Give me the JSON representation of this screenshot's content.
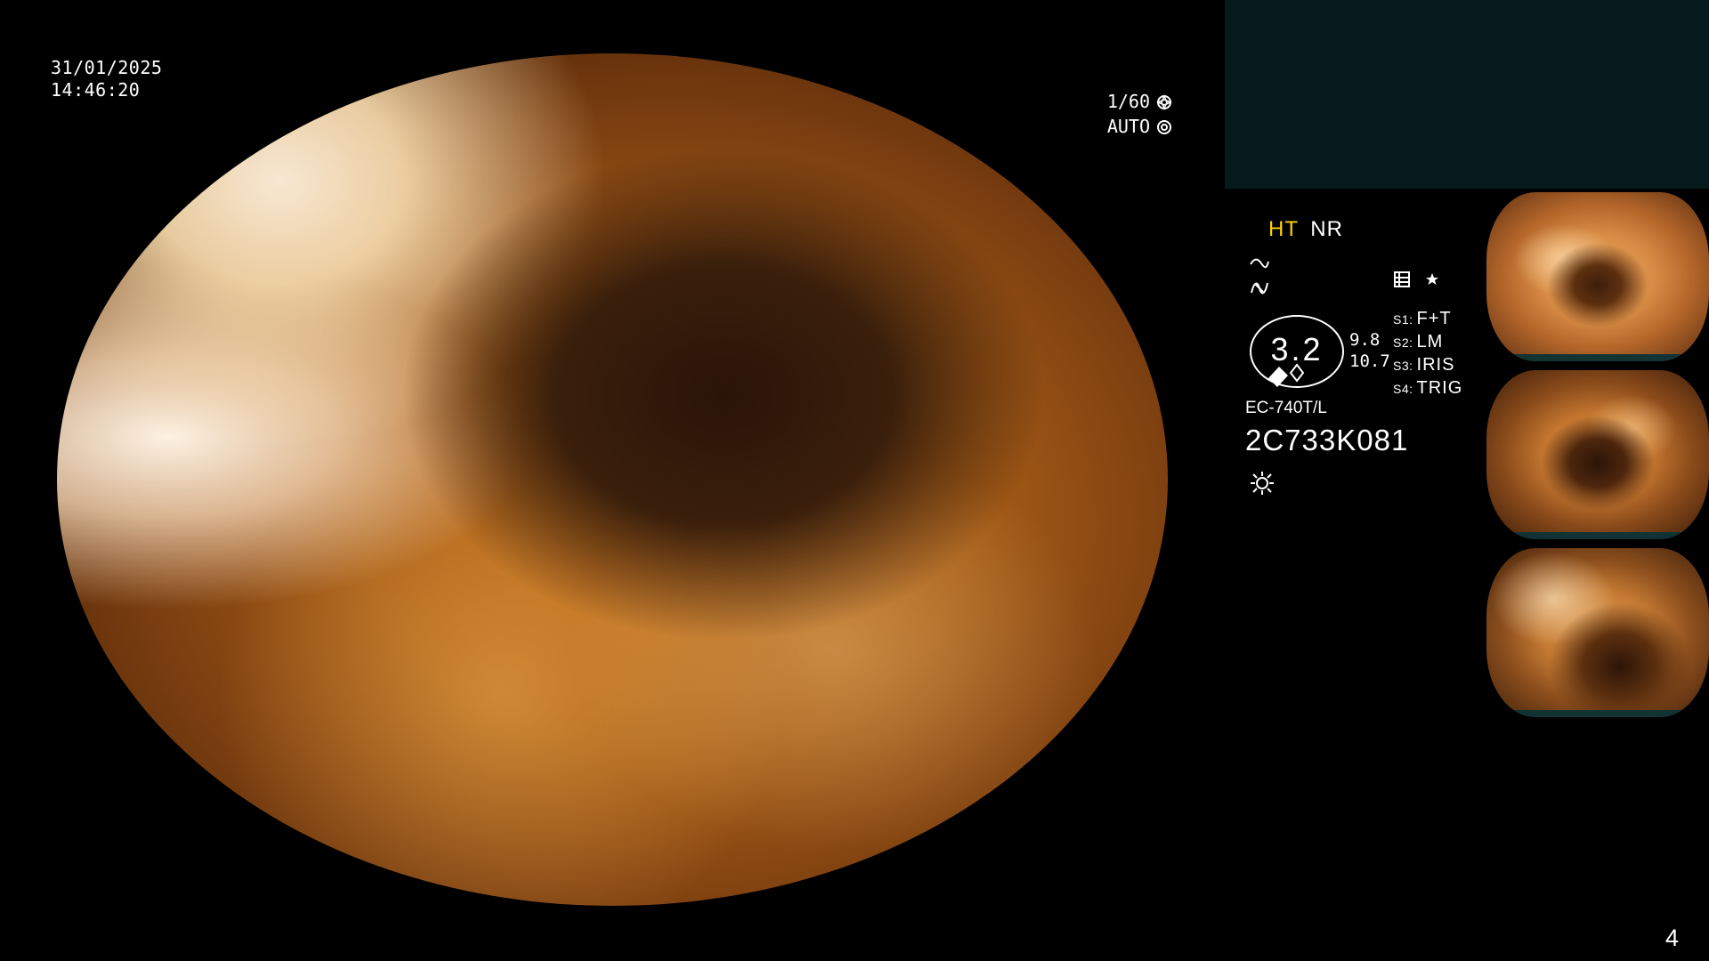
{
  "overlay": {
    "date": "31/01/2025",
    "time": "14:46:20",
    "shutter": "1/60",
    "auto": "AUTO"
  },
  "panel": {
    "ht": "HT",
    "nr": "NR",
    "circle_value": "3.2",
    "side_values": [
      "9.8",
      "10.7"
    ],
    "statuses": [
      {
        "key": "S1:",
        "value": "F+T"
      },
      {
        "key": "S2:",
        "value": "LM"
      },
      {
        "key": "S3:",
        "value": "IRIS"
      },
      {
        "key": "S4:",
        "value": "TRIG"
      }
    ],
    "model": "EC-740T/L",
    "serial": "2C733K081"
  },
  "footer": {
    "page_number": "4"
  },
  "colors": {
    "accent": "#ffd000",
    "panel_top": "#041a1d",
    "thumb_bar": "#0d3336"
  }
}
